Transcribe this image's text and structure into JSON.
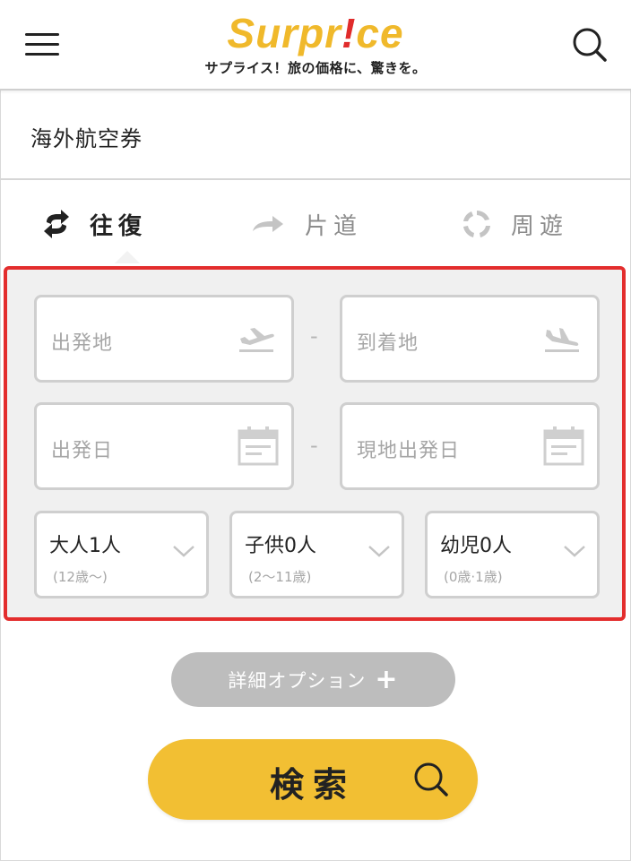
{
  "header": {
    "logo": {
      "pre": "Surpr",
      "bang": "!",
      "post": "ce"
    },
    "tagline": "サプライス！旅の価格に、驚きを。",
    "menu_icon": "hamburger-menu-icon",
    "search_icon": "search-icon"
  },
  "page": {
    "title": "海外航空券"
  },
  "trip_tabs": [
    {
      "label": "往復",
      "icon": "round-trip-arrows-icon",
      "active": true
    },
    {
      "label": "片道",
      "icon": "one-way-arrow-icon",
      "active": false
    },
    {
      "label": "周遊",
      "icon": "multi-city-cycle-icon",
      "active": false
    }
  ],
  "form": {
    "departure_place": {
      "placeholder": "出発地",
      "icon": "takeoff-icon"
    },
    "arrival_place": {
      "placeholder": "到着地",
      "icon": "landing-icon"
    },
    "departure_date": {
      "placeholder": "出発日",
      "icon": "calendar-icon"
    },
    "return_date": {
      "placeholder": "現地出発日",
      "icon": "calendar-icon"
    },
    "separator": "-",
    "passengers": [
      {
        "label": "大人1人",
        "note": "(12歳〜)"
      },
      {
        "label": "子供0人",
        "note": "(2〜11歳)"
      },
      {
        "label": "幼児0人",
        "note": "(0歳·1歳)"
      }
    ]
  },
  "detail_options": {
    "label": "詳細オプション",
    "plus": "+"
  },
  "search_button": {
    "label": "検索",
    "icon": "search-icon"
  },
  "colors": {
    "brand_yellow": "#f2bf33",
    "logo_yellow": "#f0b92b",
    "highlight_red": "#e32d2d",
    "panel_bg": "#f0f0f0",
    "muted_gray": "#bdbdbd"
  }
}
